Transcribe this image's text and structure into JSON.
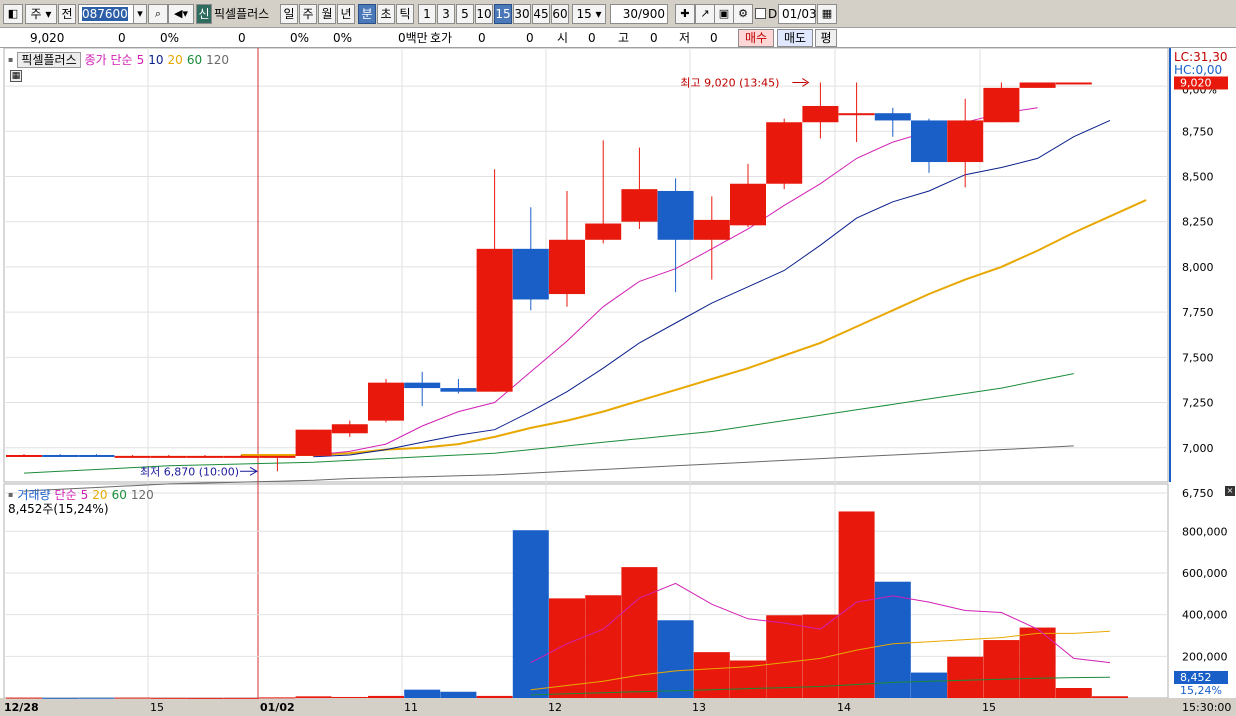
{
  "toolbar": {
    "market": "주",
    "market2": "전",
    "code": "087600",
    "shin": "신",
    "stock_name": "픽셀플러스",
    "periods": [
      "일",
      "주",
      "월",
      "년",
      "분",
      "초",
      "틱"
    ],
    "active_period": "분",
    "intervals": [
      "1",
      "3",
      "5",
      "10",
      "15",
      "30",
      "45",
      "60"
    ],
    "active_interval": "15",
    "interval_select": "15",
    "count": "30",
    "count_total": "/900",
    "d_label": "D",
    "date": "01/03"
  },
  "quote": {
    "price": "9,020",
    "change": "0",
    "rate": "0%",
    "volume": "0",
    "rate2": "0%",
    "rate3": "0%",
    "amount": "0백만",
    "hoga_label": "호가",
    "hoga1": "0",
    "hoga2": "0",
    "open_label": "시",
    "open": "0",
    "high_label": "고",
    "high": "0",
    "low_label": "저",
    "low": "0",
    "buy": "매수",
    "sell": "매도",
    "avg": "평"
  },
  "price_panel": {
    "title": "픽셀플러스",
    "ma_label": "종가 단순",
    "ma_periods": [
      "5",
      "10",
      "20",
      "60",
      "120"
    ],
    "lc": "LC:31,30",
    "hc": "HC:0,00",
    "current_price": "9,020",
    "high_annotation": "최고 9,020 (13:45)",
    "low_annotation": "최저 6,870 (10:00)",
    "y_ticks": [
      "0,00%",
      "8,750",
      "8,500",
      "8,250",
      "8,000",
      "7,750",
      "7,500",
      "7,250",
      "7,000",
      "6,750"
    ]
  },
  "volume_panel": {
    "title": "거래량",
    "ma_label": "단순",
    "ma_periods": [
      "5",
      "20",
      "60",
      "120"
    ],
    "current": "8,452주(15,24%)",
    "current_badge": "8,452",
    "current_pct": "15,24%",
    "y_ticks": [
      "800,000",
      "600,000",
      "400,000",
      "200,000"
    ]
  },
  "x_axis": {
    "labels": [
      "12/28",
      "15",
      "01/02",
      "11",
      "12",
      "13",
      "14",
      "15"
    ],
    "time": "15:30:00"
  },
  "colors": {
    "up": "#e8190c",
    "down": "#1a5fc8",
    "ma5": "#d21fb4",
    "ma10": "#0a1f8c",
    "ma20": "#e8a800",
    "ma60": "#1a8c3a",
    "ma120": "#6a6a6a"
  },
  "chart_data": {
    "type": "candlestick",
    "candles": [
      {
        "o": 6960,
        "h": 6965,
        "l": 6955,
        "c": 6960
      },
      {
        "o": 6960,
        "h": 6965,
        "l": 6950,
        "c": 6955
      },
      {
        "o": 6960,
        "h": 6965,
        "l": 6955,
        "c": 6958
      },
      {
        "o": 6955,
        "h": 6960,
        "l": 6950,
        "c": 6955
      },
      {
        "o": 6955,
        "h": 6960,
        "l": 6950,
        "c": 6955
      },
      {
        "o": 6955,
        "h": 6960,
        "l": 6950,
        "c": 6955
      },
      {
        "o": 6955,
        "h": 6960,
        "l": 6950,
        "c": 6955
      },
      {
        "o": 6950,
        "h": 6955,
        "l": 6870,
        "c": 6955
      },
      {
        "o": 6955,
        "h": 7100,
        "l": 6950,
        "c": 7100
      },
      {
        "o": 7080,
        "h": 7150,
        "l": 7060,
        "c": 7130
      },
      {
        "o": 7150,
        "h": 7380,
        "l": 7140,
        "c": 7360
      },
      {
        "o": 7360,
        "h": 7420,
        "l": 7230,
        "c": 7330
      },
      {
        "o": 7330,
        "h": 7380,
        "l": 7300,
        "c": 7310
      },
      {
        "o": 7310,
        "h": 8540,
        "l": 7310,
        "c": 8100
      },
      {
        "o": 8100,
        "h": 8330,
        "l": 7760,
        "c": 7820
      },
      {
        "o": 7850,
        "h": 8420,
        "l": 7780,
        "c": 8150
      },
      {
        "o": 8150,
        "h": 8700,
        "l": 8130,
        "c": 8240
      },
      {
        "o": 8250,
        "h": 8660,
        "l": 8210,
        "c": 8430
      },
      {
        "o": 8420,
        "h": 8490,
        "l": 7860,
        "c": 8150
      },
      {
        "o": 8150,
        "h": 8390,
        "l": 7930,
        "c": 8260
      },
      {
        "o": 8230,
        "h": 8570,
        "l": 8220,
        "c": 8460
      },
      {
        "o": 8460,
        "h": 8820,
        "l": 8430,
        "c": 8800
      },
      {
        "o": 8800,
        "h": 9020,
        "l": 8710,
        "c": 8890
      },
      {
        "o": 8850,
        "h": 9020,
        "l": 8690,
        "c": 8850
      },
      {
        "o": 8850,
        "h": 8880,
        "l": 8720,
        "c": 8810
      },
      {
        "o": 8810,
        "h": 8820,
        "l": 8520,
        "c": 8580
      },
      {
        "o": 8580,
        "h": 8930,
        "l": 8440,
        "c": 8810
      },
      {
        "o": 8800,
        "h": 9020,
        "l": 8800,
        "c": 8990
      },
      {
        "o": 8990,
        "h": 9020,
        "l": 8990,
        "c": 9020
      },
      {
        "o": 9020,
        "h": 9020,
        "l": 9020,
        "c": 9020
      }
    ],
    "ma5": [
      null,
      null,
      null,
      null,
      null,
      null,
      null,
      null,
      6960,
      6980,
      7020,
      7120,
      7200,
      7250,
      7420,
      7590,
      7780,
      7920,
      7990,
      8100,
      8210,
      8340,
      8460,
      8600,
      8690,
      8750,
      8800,
      8850,
      8880
    ],
    "ma10": [
      null,
      null,
      null,
      null,
      null,
      null,
      null,
      null,
      6950,
      6960,
      6990,
      7030,
      7070,
      7100,
      7200,
      7310,
      7440,
      7580,
      7690,
      7800,
      7890,
      7980,
      8120,
      8270,
      8360,
      8420,
      8510,
      8550,
      8600,
      8720,
      8810
    ],
    "ma20": [
      null,
      null,
      null,
      null,
      null,
      null,
      6960,
      6960,
      6960,
      6970,
      6990,
      7000,
      7020,
      7060,
      7110,
      7150,
      7200,
      7260,
      7320,
      7380,
      7440,
      7510,
      7580,
      7670,
      7760,
      7850,
      7930,
      8000,
      8090,
      8190,
      8280,
      8370
    ],
    "ma60": [
      6860,
      6870,
      6880,
      6890,
      6900,
      6905,
      6910,
      6915,
      6920,
      6930,
      6940,
      6950,
      6960,
      6970,
      6990,
      7010,
      7030,
      7050,
      7070,
      7090,
      7120,
      7150,
      7180,
      7210,
      7240,
      7270,
      7300,
      7330,
      7370,
      7410
    ],
    "ma120": [
      6760,
      6770,
      6780,
      6790,
      6800,
      6805,
      6810,
      6815,
      6820,
      6830,
      6835,
      6840,
      6845,
      6850,
      6860,
      6870,
      6880,
      6890,
      6900,
      6910,
      6920,
      6930,
      6940,
      6950,
      6960,
      6970,
      6980,
      6990,
      7000,
      7010
    ],
    "volume": [
      2000,
      1000,
      1500,
      2000,
      1000,
      500,
      800,
      3000,
      8000,
      5000,
      10000,
      40000,
      30000,
      10000,
      805000,
      478000,
      493000,
      628000,
      373000,
      220000,
      180000,
      397000,
      400000,
      895000,
      558000,
      122000,
      198000,
      278000,
      338000,
      48000,
      8452
    ],
    "vol_ma5": [
      null,
      null,
      null,
      null,
      null,
      null,
      null,
      null,
      null,
      null,
      null,
      null,
      null,
      null,
      170000,
      260000,
      330000,
      480000,
      550000,
      450000,
      380000,
      360000,
      330000,
      460000,
      490000,
      460000,
      420000,
      410000,
      330000,
      190000,
      170000
    ],
    "vol_ma20": [
      null,
      null,
      null,
      null,
      null,
      null,
      null,
      null,
      null,
      null,
      null,
      null,
      null,
      null,
      40000,
      60000,
      80000,
      110000,
      130000,
      140000,
      150000,
      170000,
      190000,
      230000,
      260000,
      270000,
      280000,
      290000,
      310000,
      310000,
      320000
    ],
    "vol_ma60": [
      null,
      null,
      null,
      null,
      null,
      null,
      null,
      null,
      null,
      null,
      null,
      null,
      null,
      null,
      15000,
      20000,
      25000,
      30000,
      35000,
      40000,
      45000,
      50000,
      55000,
      65000,
      75000,
      80000,
      85000,
      90000,
      95000,
      98000,
      100000
    ],
    "price_ylim": [
      6700,
      9100
    ],
    "volume_ylim": [
      0,
      950000
    ]
  }
}
